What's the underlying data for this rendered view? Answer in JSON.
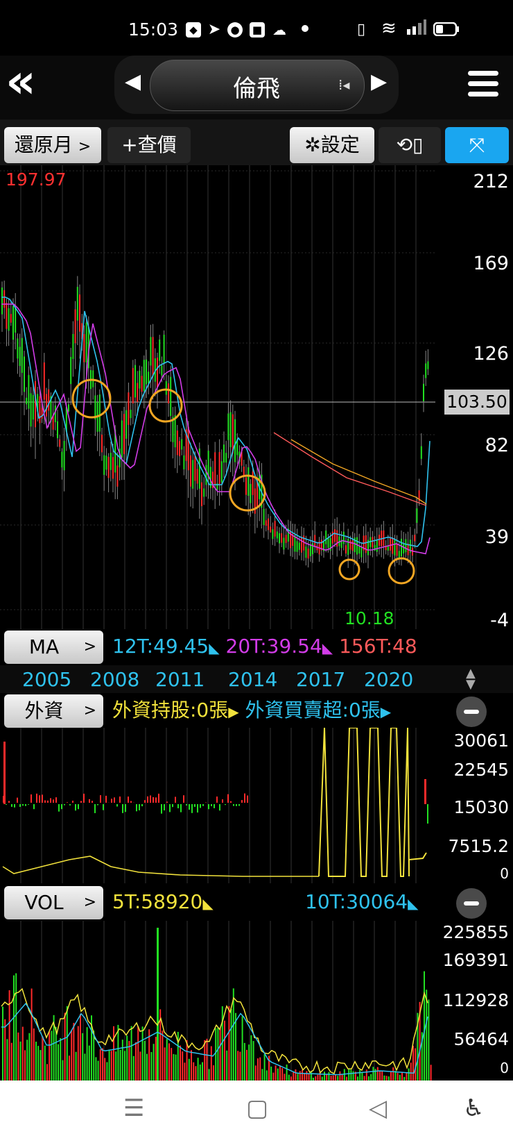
{
  "status_bar": {
    "time": "15:03"
  },
  "header": {
    "title": "倫飛"
  },
  "toolbar": {
    "restore_month": "還原月",
    "query_price": "+查價",
    "settings": "設定"
  },
  "main_chart": {
    "max_label": "197.97",
    "min_label": "10.18",
    "y_ticks": [
      "212",
      "169",
      "126",
      "82",
      "39",
      "-4"
    ],
    "current_price": "103.50"
  },
  "ma_row": {
    "button": "MA",
    "legend": [
      {
        "label": "12T:49.45",
        "color": "#2fc2ee"
      },
      {
        "label": "20T:39.54",
        "color": "#d23ce8"
      },
      {
        "label": "156T:48",
        "color": "#ff5a5a"
      }
    ]
  },
  "year_axis": [
    "2005",
    "2008",
    "2011",
    "2014",
    "2017",
    "2020"
  ],
  "foreign_row": {
    "button": "外資",
    "legend": [
      {
        "label": "外資持股:0張",
        "color": "#f2e23c"
      },
      {
        "label": "外資買賣超:0張",
        "color": "#2fc2ee"
      }
    ],
    "y_ticks": [
      "30061",
      "22545",
      "15030",
      "7515.2",
      "0"
    ]
  },
  "vol_row": {
    "button": "VOL",
    "legend": [
      {
        "label": "5T:58920",
        "color": "#f2e23c"
      },
      {
        "label": "10T:30064",
        "color": "#2fc2ee"
      }
    ],
    "y_ticks": [
      "225855",
      "169391",
      "112928",
      "56464",
      "0"
    ]
  },
  "colors": {
    "up": "#ff2a2a",
    "down": "#22e022",
    "accent": "#1aa6f0",
    "highlight": "#f2a623"
  }
}
